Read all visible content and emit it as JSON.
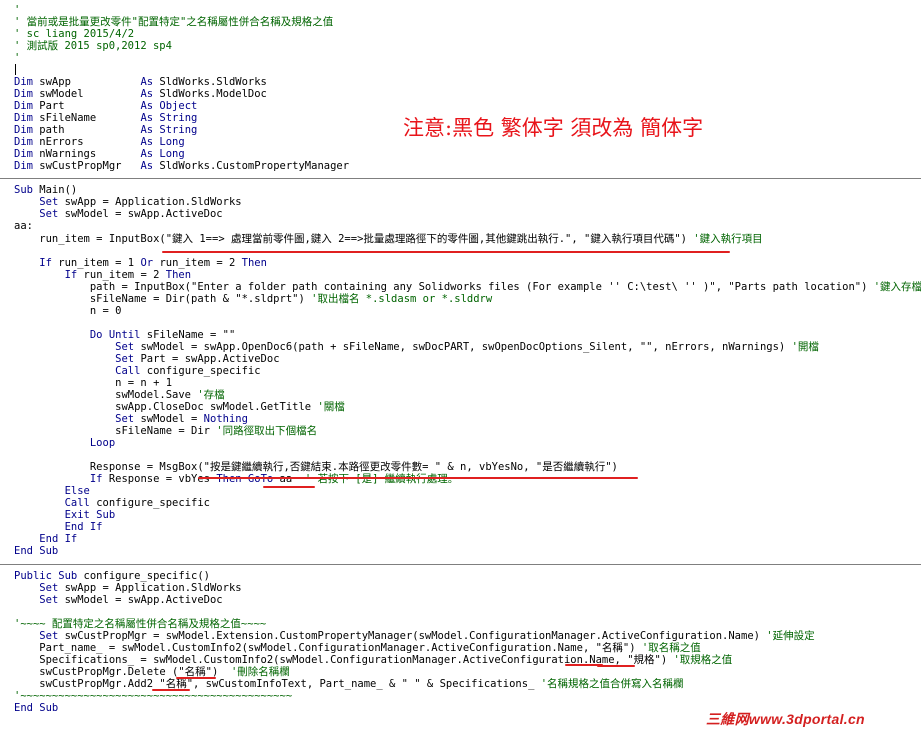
{
  "code_lines": [
    {
      "segments": [
        {
          "t": "'",
          "c": "cm"
        }
      ]
    },
    {
      "segments": [
        {
          "t": "' 當前或是批量更改零件\"配置特定\"之名稱屬性併合名稱及規格之值",
          "c": "cm"
        }
      ]
    },
    {
      "segments": [
        {
          "t": "' sc liang 2015/4/2",
          "c": "cm"
        }
      ]
    },
    {
      "segments": [
        {
          "t": "' 測試版 2015 sp0,2012 sp4",
          "c": "cm"
        }
      ]
    },
    {
      "segments": [
        {
          "t": "'",
          "c": "cm"
        }
      ]
    },
    {
      "segments": [
        {
          "t": "",
          "c": "tx"
        }
      ]
    },
    {
      "segments": [
        {
          "t": "Dim",
          "c": "kw"
        },
        {
          "t": " swApp           ",
          "c": "tx"
        },
        {
          "t": "As",
          "c": "kw"
        },
        {
          "t": " SldWorks.SldWorks",
          "c": "tx"
        }
      ]
    },
    {
      "segments": [
        {
          "t": "Dim",
          "c": "kw"
        },
        {
          "t": " swModel         ",
          "c": "tx"
        },
        {
          "t": "As",
          "c": "kw"
        },
        {
          "t": " SldWorks.ModelDoc",
          "c": "tx"
        }
      ]
    },
    {
      "segments": [
        {
          "t": "Dim",
          "c": "kw"
        },
        {
          "t": " Part            ",
          "c": "tx"
        },
        {
          "t": "As Object",
          "c": "kw"
        }
      ]
    },
    {
      "segments": [
        {
          "t": "Dim",
          "c": "kw"
        },
        {
          "t": " sFileName       ",
          "c": "tx"
        },
        {
          "t": "As String",
          "c": "kw"
        }
      ]
    },
    {
      "segments": [
        {
          "t": "Dim",
          "c": "kw"
        },
        {
          "t": " path            ",
          "c": "tx"
        },
        {
          "t": "As String",
          "c": "kw"
        }
      ]
    },
    {
      "segments": [
        {
          "t": "Dim",
          "c": "kw"
        },
        {
          "t": " nErrors         ",
          "c": "tx"
        },
        {
          "t": "As Long",
          "c": "kw"
        }
      ]
    },
    {
      "segments": [
        {
          "t": "Dim",
          "c": "kw"
        },
        {
          "t": " nWarnings       ",
          "c": "tx"
        },
        {
          "t": "As Long",
          "c": "kw"
        }
      ]
    },
    {
      "segments": [
        {
          "t": "Dim",
          "c": "kw"
        },
        {
          "t": " swCustPropMgr   ",
          "c": "tx"
        },
        {
          "t": "As",
          "c": "kw"
        },
        {
          "t": " SldWorks.CustomPropertyManager",
          "c": "tx"
        }
      ]
    },
    {
      "segments": [
        {
          "t": "",
          "c": "tx"
        }
      ]
    },
    {
      "segments": [
        {
          "t": "Sub",
          "c": "kw"
        },
        {
          "t": " Main()",
          "c": "tx"
        }
      ]
    },
    {
      "segments": [
        {
          "t": "    ",
          "c": "tx"
        },
        {
          "t": "Set",
          "c": "kw"
        },
        {
          "t": " swApp = Application.SldWorks",
          "c": "tx"
        }
      ]
    },
    {
      "segments": [
        {
          "t": "    ",
          "c": "tx"
        },
        {
          "t": "Set",
          "c": "kw"
        },
        {
          "t": " swModel = swApp.ActiveDoc",
          "c": "tx"
        }
      ]
    },
    {
      "segments": [
        {
          "t": "aa:",
          "c": "tx"
        }
      ]
    },
    {
      "segments": [
        {
          "t": "    run_item = InputBox(\"鍵入 1==> 處理當前零件圖,鍵入 2==>批量處理路徑下的零件圖,其他鍵跳出執行.\", \"鍵入執行項目代碼\") ",
          "c": "tx"
        },
        {
          "t": "'鍵入執行項目",
          "c": "cm"
        }
      ]
    },
    {
      "segments": [
        {
          "t": "",
          "c": "tx"
        }
      ]
    },
    {
      "segments": [
        {
          "t": "    ",
          "c": "tx"
        },
        {
          "t": "If",
          "c": "kw"
        },
        {
          "t": " run_item = 1 ",
          "c": "tx"
        },
        {
          "t": "Or",
          "c": "kw"
        },
        {
          "t": " run_item = 2 ",
          "c": "tx"
        },
        {
          "t": "Then",
          "c": "kw"
        }
      ]
    },
    {
      "segments": [
        {
          "t": "        ",
          "c": "tx"
        },
        {
          "t": "If",
          "c": "kw"
        },
        {
          "t": " run_item = 2 ",
          "c": "tx"
        },
        {
          "t": "Then",
          "c": "kw"
        }
      ]
    },
    {
      "segments": [
        {
          "t": "            path = InputBox(\"Enter a folder path containing any Solidworks files (For example '' C:\\test\\ '' )\", \"Parts path location\") ",
          "c": "tx"
        },
        {
          "t": "'鍵入存檔路徑",
          "c": "cm"
        }
      ]
    },
    {
      "segments": [
        {
          "t": "            sFileName = Dir(path & \"*.sldprt\") ",
          "c": "tx"
        },
        {
          "t": "'取出檔名 *.sldasm or *.slddrw",
          "c": "cm"
        }
      ]
    },
    {
      "segments": [
        {
          "t": "            n = 0",
          "c": "tx"
        }
      ]
    },
    {
      "segments": [
        {
          "t": "",
          "c": "tx"
        }
      ]
    },
    {
      "segments": [
        {
          "t": "            ",
          "c": "tx"
        },
        {
          "t": "Do Until",
          "c": "kw"
        },
        {
          "t": " sFileName = \"\"",
          "c": "tx"
        }
      ]
    },
    {
      "segments": [
        {
          "t": "                ",
          "c": "tx"
        },
        {
          "t": "Set",
          "c": "kw"
        },
        {
          "t": " swModel = swApp.OpenDoc6(path + sFileName, swDocPART, swOpenDocOptions_Silent, \"\", nErrors, nWarnings) ",
          "c": "tx"
        },
        {
          "t": "'開檔",
          "c": "cm"
        }
      ]
    },
    {
      "segments": [
        {
          "t": "                ",
          "c": "tx"
        },
        {
          "t": "Set",
          "c": "kw"
        },
        {
          "t": " Part = swApp.ActiveDoc",
          "c": "tx"
        }
      ]
    },
    {
      "segments": [
        {
          "t": "                ",
          "c": "tx"
        },
        {
          "t": "Call",
          "c": "kw"
        },
        {
          "t": " configure_specific",
          "c": "tx"
        }
      ]
    },
    {
      "segments": [
        {
          "t": "                n = n + 1",
          "c": "tx"
        }
      ]
    },
    {
      "segments": [
        {
          "t": "                swModel.Save ",
          "c": "tx"
        },
        {
          "t": "'存檔",
          "c": "cm"
        }
      ]
    },
    {
      "segments": [
        {
          "t": "                swApp.CloseDoc swModel.GetTitle ",
          "c": "tx"
        },
        {
          "t": "'關檔",
          "c": "cm"
        }
      ]
    },
    {
      "segments": [
        {
          "t": "                ",
          "c": "tx"
        },
        {
          "t": "Set",
          "c": "kw"
        },
        {
          "t": " swModel = ",
          "c": "tx"
        },
        {
          "t": "Nothing",
          "c": "kw"
        }
      ]
    },
    {
      "segments": [
        {
          "t": "                sFileName = Dir ",
          "c": "tx"
        },
        {
          "t": "'同路徑取出下個檔名",
          "c": "cm"
        }
      ]
    },
    {
      "segments": [
        {
          "t": "            ",
          "c": "tx"
        },
        {
          "t": "Loop",
          "c": "kw"
        }
      ]
    },
    {
      "segments": [
        {
          "t": "",
          "c": "tx"
        }
      ]
    },
    {
      "segments": [
        {
          "t": "            Response = MsgBox(\"按是鍵繼續執行,否鍵結束.本路徑更改零件數= \" & n, vbYesNo, \"是否繼續執行\")",
          "c": "tx"
        }
      ]
    },
    {
      "segments": [
        {
          "t": "            ",
          "c": "tx"
        },
        {
          "t": "If",
          "c": "kw"
        },
        {
          "t": " Response = vbYes ",
          "c": "tx"
        },
        {
          "t": "Then GoTo",
          "c": "kw"
        },
        {
          "t": " aa  ",
          "c": "tx"
        },
        {
          "t": "' 若按下 [是] 繼續執行處理。",
          "c": "cm"
        }
      ]
    },
    {
      "segments": [
        {
          "t": "        ",
          "c": "tx"
        },
        {
          "t": "Else",
          "c": "kw"
        }
      ]
    },
    {
      "segments": [
        {
          "t": "        ",
          "c": "tx"
        },
        {
          "t": "Call",
          "c": "kw"
        },
        {
          "t": " configure_specific",
          "c": "tx"
        }
      ]
    },
    {
      "segments": [
        {
          "t": "        ",
          "c": "tx"
        },
        {
          "t": "Exit Sub",
          "c": "kw"
        }
      ]
    },
    {
      "segments": [
        {
          "t": "        ",
          "c": "tx"
        },
        {
          "t": "End If",
          "c": "kw"
        }
      ]
    },
    {
      "segments": [
        {
          "t": "    ",
          "c": "tx"
        },
        {
          "t": "End If",
          "c": "kw"
        }
      ]
    },
    {
      "segments": [
        {
          "t": "End Sub",
          "c": "kw"
        }
      ]
    },
    {
      "segments": [
        {
          "t": "",
          "c": "tx"
        }
      ]
    },
    {
      "segments": [
        {
          "t": "Public Sub",
          "c": "kw"
        },
        {
          "t": " configure_specific()",
          "c": "tx"
        }
      ]
    },
    {
      "segments": [
        {
          "t": "    ",
          "c": "tx"
        },
        {
          "t": "Set",
          "c": "kw"
        },
        {
          "t": " swApp = Application.SldWorks",
          "c": "tx"
        }
      ]
    },
    {
      "segments": [
        {
          "t": "    ",
          "c": "tx"
        },
        {
          "t": "Set",
          "c": "kw"
        },
        {
          "t": " swModel = swApp.ActiveDoc",
          "c": "tx"
        }
      ]
    },
    {
      "segments": [
        {
          "t": "",
          "c": "tx"
        }
      ]
    },
    {
      "segments": [
        {
          "t": "'~~~~ 配置特定之名稱屬性併合名稱及規格之值~~~~",
          "c": "cm"
        }
      ]
    },
    {
      "segments": [
        {
          "t": "    ",
          "c": "tx"
        },
        {
          "t": "Set",
          "c": "kw"
        },
        {
          "t": " swCustPropMgr = swModel.Extension.CustomPropertyManager(swModel.ConfigurationManager.ActiveConfiguration.Name) ",
          "c": "tx"
        },
        {
          "t": "'延伸設定",
          "c": "cm"
        }
      ]
    },
    {
      "segments": [
        {
          "t": "    Part_name_ = swModel.CustomInfo2(swModel.ConfigurationManager.ActiveConfiguration.Name, \"名稱\") ",
          "c": "tx"
        },
        {
          "t": "'取名稱之值",
          "c": "cm"
        }
      ]
    },
    {
      "segments": [
        {
          "t": "    Specifications_ = swModel.CustomInfo2(swModel.ConfigurationManager.ActiveConfiguration.Name, \"規格\") ",
          "c": "tx"
        },
        {
          "t": "'取規格之值",
          "c": "cm"
        }
      ]
    },
    {
      "segments": [
        {
          "t": "    swCustPropMgr.Delete (\"名稱\")  ",
          "c": "tx"
        },
        {
          "t": "'刪除名稱欄",
          "c": "cm"
        }
      ]
    },
    {
      "segments": [
        {
          "t": "    swCustPropMgr.Add2 \"名稱\", swCustomInfoText, Part_name_ & \" \" & Specifications_ ",
          "c": "tx"
        },
        {
          "t": "'名稱規格之值合併寫入名稱欄",
          "c": "cm"
        }
      ]
    },
    {
      "segments": [
        {
          "t": "'~~~~~~~~~~~~~~~~~~~~~~~~~~~~~~~~~~~~~~~~~~~",
          "c": "cm"
        }
      ]
    },
    {
      "segments": [
        {
          "t": "End Sub",
          "c": "kw"
        }
      ]
    }
  ],
  "annotation": {
    "note_text": "注意:黑色 繁体字 須改為 簡体字"
  },
  "watermark": {
    "text": "三維网www.3dportal.cn"
  },
  "colors": {
    "keyword": "#00008b",
    "comment": "#006400",
    "annotation": "#e8141a",
    "underline": "#e02020"
  }
}
